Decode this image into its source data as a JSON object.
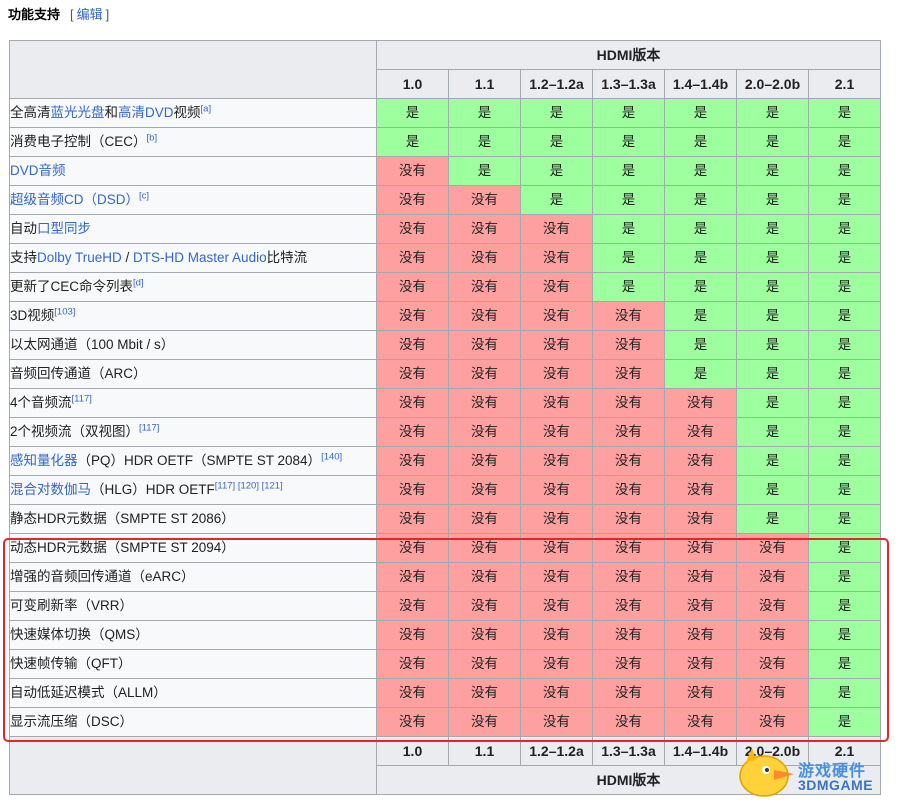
{
  "header": {
    "section_title": "功能支持",
    "edit_bracket_open": "[",
    "edit_link": "编辑",
    "edit_bracket_close": "]"
  },
  "table": {
    "group_header": "HDMI版本",
    "versions": [
      "1.0",
      "1.1",
      "1.2–1.2a",
      "1.3–1.3a",
      "1.4–1.4b",
      "2.0–2.0b",
      "2.1"
    ],
    "yes_label": "是",
    "no_label": "没有",
    "rows": [
      {
        "feature": [
          {
            "t": "全高清"
          },
          {
            "t": "蓝光光盘",
            "link": true
          },
          {
            "t": "和"
          },
          {
            "t": "高清DVD",
            "link": true
          },
          {
            "t": "视频"
          },
          {
            "t": "[a]",
            "sup": true
          }
        ],
        "support": [
          1,
          1,
          1,
          1,
          1,
          1,
          1
        ]
      },
      {
        "feature": [
          {
            "t": "消费电子控制（CEC）"
          },
          {
            "t": "[b]",
            "sup": true
          }
        ],
        "support": [
          1,
          1,
          1,
          1,
          1,
          1,
          1
        ]
      },
      {
        "feature": [
          {
            "t": "DVD音频",
            "link": true
          }
        ],
        "support": [
          0,
          1,
          1,
          1,
          1,
          1,
          1
        ]
      },
      {
        "feature": [
          {
            "t": "超级音频CD（DSD）",
            "link": true
          },
          {
            "t": "[c]",
            "sup": true
          }
        ],
        "support": [
          0,
          0,
          1,
          1,
          1,
          1,
          1
        ]
      },
      {
        "feature": [
          {
            "t": "自动"
          },
          {
            "t": "口型同步",
            "link": true
          }
        ],
        "support": [
          0,
          0,
          0,
          1,
          1,
          1,
          1
        ]
      },
      {
        "feature": [
          {
            "t": "支持"
          },
          {
            "t": "Dolby TrueHD",
            "link": true
          },
          {
            "t": " / "
          },
          {
            "t": "DTS-HD Master Audio",
            "link": true
          },
          {
            "t": "比特流"
          }
        ],
        "support": [
          0,
          0,
          0,
          1,
          1,
          1,
          1
        ]
      },
      {
        "feature": [
          {
            "t": "更新了CEC命令列表"
          },
          {
            "t": "[d]",
            "sup": true
          }
        ],
        "support": [
          0,
          0,
          0,
          1,
          1,
          1,
          1
        ]
      },
      {
        "feature": [
          {
            "t": "3D视频"
          },
          {
            "t": "[103]",
            "sup": true
          }
        ],
        "support": [
          0,
          0,
          0,
          0,
          1,
          1,
          1
        ]
      },
      {
        "feature": [
          {
            "t": "以太网通道（100  Mbit / s）"
          }
        ],
        "support": [
          0,
          0,
          0,
          0,
          1,
          1,
          1
        ]
      },
      {
        "feature": [
          {
            "t": "音频回传通道（ARC）"
          }
        ],
        "support": [
          0,
          0,
          0,
          0,
          1,
          1,
          1
        ]
      },
      {
        "feature": [
          {
            "t": "4个音频流"
          },
          {
            "t": "[117]",
            "sup": true
          }
        ],
        "support": [
          0,
          0,
          0,
          0,
          0,
          1,
          1
        ]
      },
      {
        "feature": [
          {
            "t": "2个视频流（双视图）"
          },
          {
            "t": "[117]",
            "sup": true
          }
        ],
        "support": [
          0,
          0,
          0,
          0,
          0,
          1,
          1
        ]
      },
      {
        "feature": [
          {
            "t": "感知量化器",
            "link": true
          },
          {
            "t": "（PQ）HDR OETF（SMPTE ST 2084）"
          },
          {
            "t": "[140]",
            "sup": true
          }
        ],
        "support": [
          0,
          0,
          0,
          0,
          0,
          1,
          1
        ]
      },
      {
        "feature": [
          {
            "t": "混合对数伽马",
            "link": true
          },
          {
            "t": "（HLG）HDR OETF"
          },
          {
            "t": "[117] [120] [121]",
            "sup": true
          }
        ],
        "support": [
          0,
          0,
          0,
          0,
          0,
          1,
          1
        ]
      },
      {
        "feature": [
          {
            "t": "静态HDR元数据（SMPTE ST 2086）"
          }
        ],
        "support": [
          0,
          0,
          0,
          0,
          0,
          1,
          1
        ]
      },
      {
        "feature": [
          {
            "t": "动态HDR元数据（SMPTE ST 2094）"
          }
        ],
        "support": [
          0,
          0,
          0,
          0,
          0,
          0,
          1
        ]
      },
      {
        "feature": [
          {
            "t": "增强的音频回传通道（eARC）"
          }
        ],
        "support": [
          0,
          0,
          0,
          0,
          0,
          0,
          1
        ]
      },
      {
        "feature": [
          {
            "t": "可变刷新率（VRR）"
          }
        ],
        "support": [
          0,
          0,
          0,
          0,
          0,
          0,
          1
        ]
      },
      {
        "feature": [
          {
            "t": "快速媒体切换（QMS）"
          }
        ],
        "support": [
          0,
          0,
          0,
          0,
          0,
          0,
          1
        ]
      },
      {
        "feature": [
          {
            "t": "快速帧传输（QFT）"
          }
        ],
        "support": [
          0,
          0,
          0,
          0,
          0,
          0,
          1
        ]
      },
      {
        "feature": [
          {
            "t": "自动低延迟模式（ALLM）"
          }
        ],
        "support": [
          0,
          0,
          0,
          0,
          0,
          0,
          1
        ]
      },
      {
        "feature": [
          {
            "t": "显示流压缩（DSC）"
          }
        ],
        "support": [
          0,
          0,
          0,
          0,
          0,
          0,
          1
        ]
      }
    ]
  },
  "watermark": {
    "line1": "游戏硬件",
    "line2": "3DMGAME"
  },
  "colors": {
    "yes": "#9eff9e",
    "no": "#ffa0a0",
    "link": "#3366cc",
    "highlight": "#e3262a"
  }
}
